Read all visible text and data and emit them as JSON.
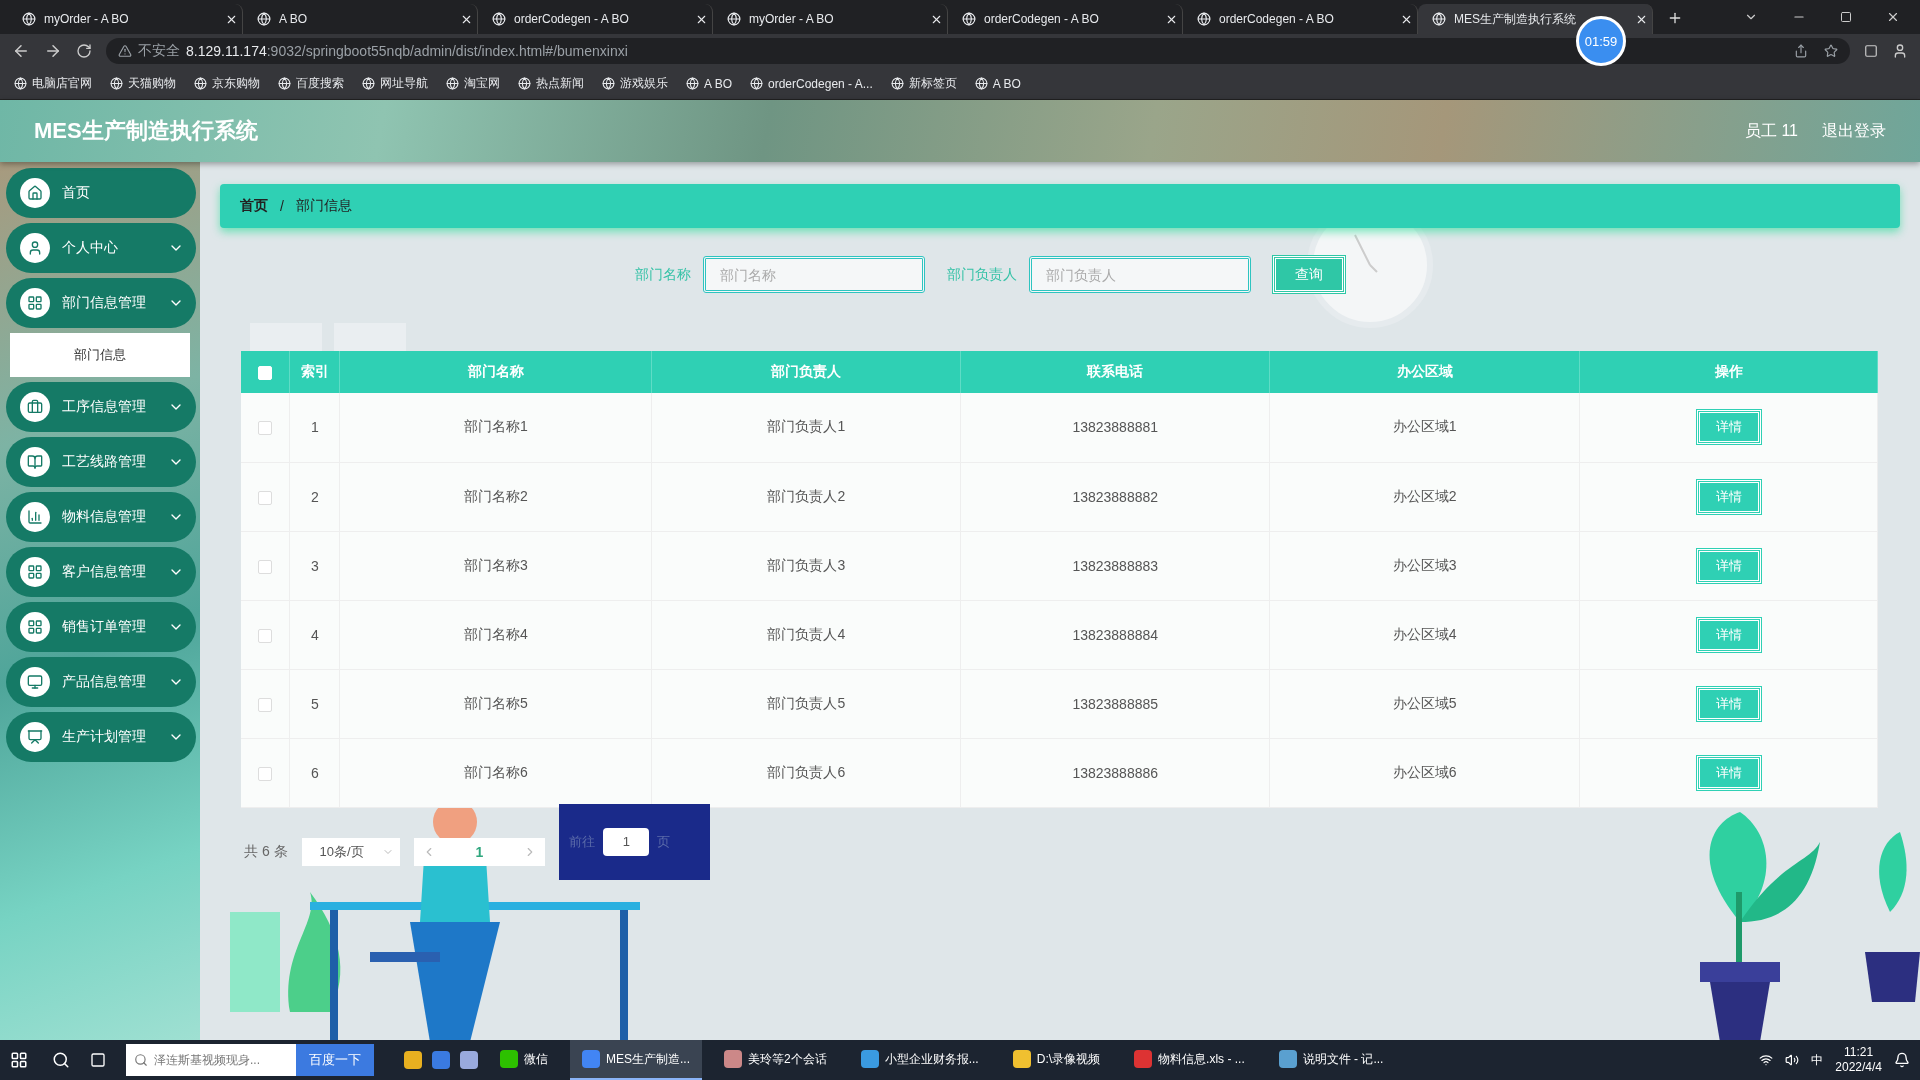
{
  "browser": {
    "tabs": [
      {
        "title": "myOrder - A BO",
        "selected": false
      },
      {
        "title": "A BO",
        "selected": false
      },
      {
        "title": "orderCodegen - A BO",
        "selected": false
      },
      {
        "title": "myOrder - A BO",
        "selected": false
      },
      {
        "title": "orderCodegen - A BO",
        "selected": false
      },
      {
        "title": "orderCodegen - A BO",
        "selected": false
      },
      {
        "title": "MES生产制造执行系统",
        "selected": true
      }
    ],
    "insecure_label": "不安全",
    "host": "8.129.11.174",
    "path": ":9032/springboot55nqb/admin/dist/index.html#/bumenxinxi",
    "bookmarks": [
      "电脑店官网",
      "天猫购物",
      "京东购物",
      "百度搜索",
      "网址导航",
      "淘宝网",
      "热点新闻",
      "游戏娱乐",
      "A BO",
      "orderCodegen - A...",
      "新标签页",
      "A BO"
    ],
    "timer": "01:59"
  },
  "app": {
    "title": "MES生产制造执行系统",
    "user": "员工 11",
    "logout": "退出登录"
  },
  "sidebar": {
    "items": [
      {
        "label": "首页",
        "kind": "link"
      },
      {
        "label": "个人中心",
        "kind": "menu"
      },
      {
        "label": "部门信息管理",
        "kind": "menu",
        "children": [
          {
            "label": "部门信息",
            "selected": true
          }
        ]
      },
      {
        "label": "工序信息管理",
        "kind": "menu"
      },
      {
        "label": "工艺线路管理",
        "kind": "menu"
      },
      {
        "label": "物料信息管理",
        "kind": "menu"
      },
      {
        "label": "客户信息管理",
        "kind": "menu"
      },
      {
        "label": "销售订单管理",
        "kind": "menu"
      },
      {
        "label": "产品信息管理",
        "kind": "menu"
      },
      {
        "label": "生产计划管理",
        "kind": "menu"
      }
    ]
  },
  "breadcrumb": [
    "首页",
    "部门信息"
  ],
  "breadcrumb_separator": "/",
  "search": {
    "fields": [
      {
        "label": "部门名称",
        "placeholder": "部门名称"
      },
      {
        "label": "部门负责人",
        "placeholder": "部门负责人"
      }
    ],
    "button": "查询"
  },
  "table": {
    "header_checked": false,
    "columns": [
      "索引",
      "部门名称",
      "部门负责人",
      "联系电话",
      "办公区域",
      "操作"
    ],
    "rows": [
      {
        "checked": false,
        "cells": [
          "1",
          "部门名称1",
          "部门负责人1",
          "13823888881",
          "办公区域1"
        ],
        "action": "详情"
      },
      {
        "checked": false,
        "cells": [
          "2",
          "部门名称2",
          "部门负责人2",
          "13823888882",
          "办公区域2"
        ],
        "action": "详情"
      },
      {
        "checked": false,
        "cells": [
          "3",
          "部门名称3",
          "部门负责人3",
          "13823888883",
          "办公区域3"
        ],
        "action": "详情"
      },
      {
        "checked": false,
        "cells": [
          "4",
          "部门名称4",
          "部门负责人4",
          "13823888884",
          "办公区域4"
        ],
        "action": "详情"
      },
      {
        "checked": false,
        "cells": [
          "5",
          "部门名称5",
          "部门负责人5",
          "13823888885",
          "办公区域5"
        ],
        "action": "详情"
      },
      {
        "checked": false,
        "cells": [
          "6",
          "部门名称6",
          "部门负责人6",
          "13823888886",
          "办公区域6"
        ],
        "action": "详情"
      }
    ]
  },
  "pagination": {
    "total": "共 6 条",
    "page_size": "10条/页",
    "pages": [
      {
        "label": "1",
        "selected": true
      }
    ],
    "goto_label": "前往",
    "goto_value": "1",
    "goto_suffix": "页"
  },
  "taskbar": {
    "search_placeholder": "泽连斯基视频现身...",
    "search_button": "百度一下",
    "apps": [
      {
        "label": "微信",
        "active": false
      },
      {
        "label": "MES生产制造...",
        "active": true
      },
      {
        "label": "美玲等2个会话",
        "active": false
      },
      {
        "label": "小型企业财务报...",
        "active": false
      },
      {
        "label": "D:\\录像视频",
        "active": false
      },
      {
        "label": "物料信息.xls - ...",
        "active": false
      },
      {
        "label": "说明文件 - 记...",
        "active": false
      }
    ],
    "ime": "中",
    "time": "11:21",
    "date": "2022/4/4"
  }
}
